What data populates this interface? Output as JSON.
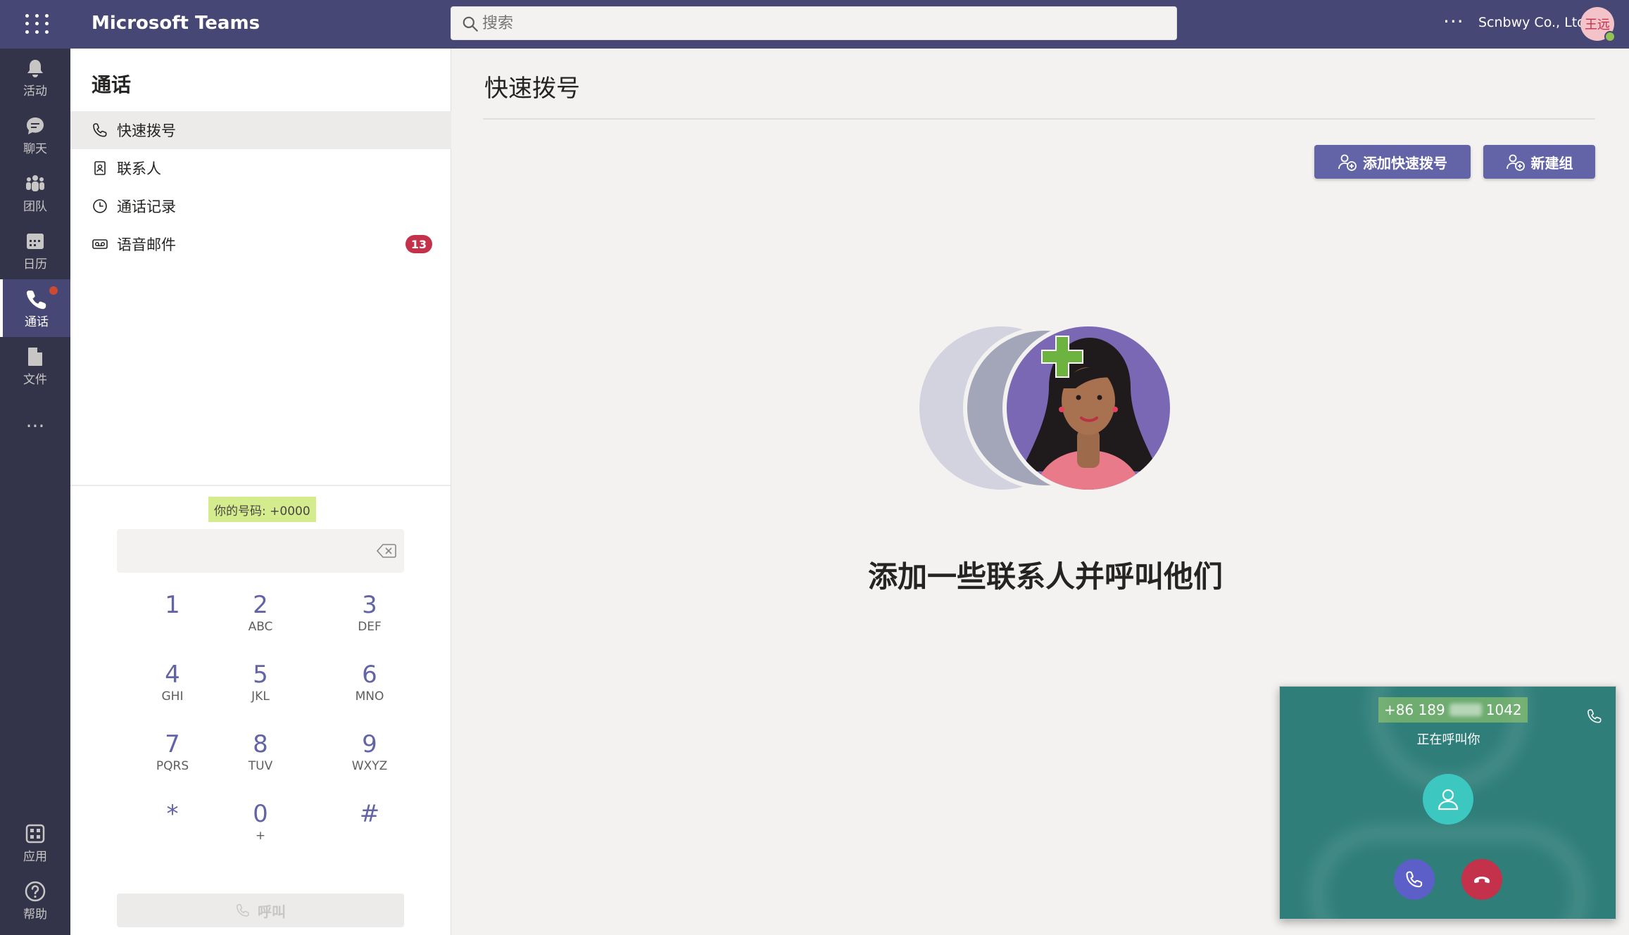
{
  "app": {
    "title": "Microsoft Teams",
    "org_name": "Scnbwy Co., Ltd",
    "user_initials": "王远",
    "more": "···"
  },
  "search": {
    "placeholder": "搜索",
    "value": ""
  },
  "rail": {
    "items": [
      {
        "label": "活动",
        "icon": "bell-icon"
      },
      {
        "label": "聊天",
        "icon": "chat-icon"
      },
      {
        "label": "团队",
        "icon": "teams-icon"
      },
      {
        "label": "日历",
        "icon": "calendar-icon"
      },
      {
        "label": "通话",
        "icon": "phone-icon",
        "active": true
      },
      {
        "label": "文件",
        "icon": "file-icon"
      }
    ],
    "more": "···",
    "bottom": [
      {
        "label": "应用",
        "icon": "apps-icon"
      },
      {
        "label": "帮助",
        "icon": "help-icon"
      }
    ]
  },
  "sidebar": {
    "title": "通话",
    "items": [
      {
        "label": "快速拨号",
        "icon": "phone-icon",
        "active": true
      },
      {
        "label": "联系人",
        "icon": "contact-card-icon"
      },
      {
        "label": "通话记录",
        "icon": "clock-icon"
      },
      {
        "label": "语音邮件",
        "icon": "voicemail-icon",
        "badge": "13"
      }
    ]
  },
  "dialpad": {
    "your_number": "你的号码: +0000",
    "input_value": "",
    "keys": [
      {
        "digit": "1",
        "letters": ""
      },
      {
        "digit": "2",
        "letters": "ABC"
      },
      {
        "digit": "3",
        "letters": "DEF"
      },
      {
        "digit": "4",
        "letters": "GHI"
      },
      {
        "digit": "5",
        "letters": "JKL"
      },
      {
        "digit": "6",
        "letters": "MNO"
      },
      {
        "digit": "7",
        "letters": "PQRS"
      },
      {
        "digit": "8",
        "letters": "TUV"
      },
      {
        "digit": "9",
        "letters": "WXYZ"
      },
      {
        "digit": "*",
        "letters": ""
      },
      {
        "digit": "0",
        "letters": "+"
      },
      {
        "digit": "#",
        "letters": ""
      }
    ],
    "call_label": "呼叫"
  },
  "main": {
    "title": "快速拨号",
    "add_speed_dial_label": "添加快速拨号",
    "new_group_label": "新建组",
    "empty_title": "添加一些联系人并呼叫他们"
  },
  "incoming_call": {
    "number_prefix": "+86 189",
    "number_suffix": "1042",
    "status": "正在呼叫你"
  },
  "colors": {
    "topbar": "#464775",
    "rail": "#33344a",
    "accent": "#6264a7",
    "badge": "#c4314b",
    "call_popup": "#2f7e7a",
    "decline": "#c4314b"
  }
}
